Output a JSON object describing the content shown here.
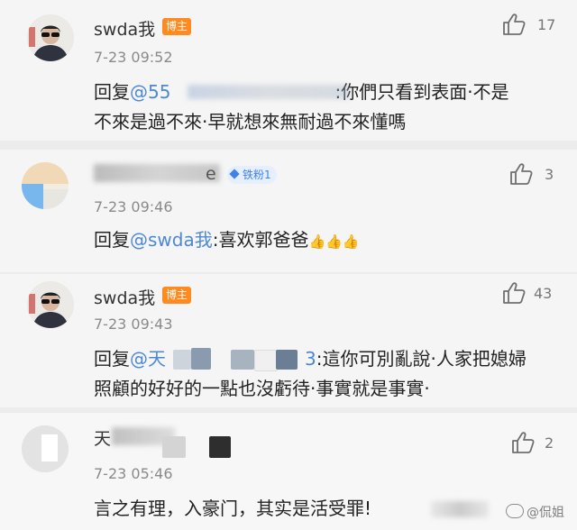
{
  "comments": [
    {
      "username": "swda我",
      "badge": "博主",
      "time": "7-23 09:52",
      "likes": "17",
      "reply_prefix": "回复",
      "mention": "@55",
      "line1_rest": ":你們只看到表面·不是",
      "line2": "不來是過不來·早就想來無耐過不來懂嗎"
    },
    {
      "username": "",
      "username_tail": "e",
      "fan_badge": "铁粉1",
      "time": "7-23 09:46",
      "likes": "3",
      "reply_prefix": "回复",
      "mention": "@swda我",
      "text": ":喜欢郭爸爸",
      "emoji": "👍👍👍"
    },
    {
      "username": "swda我",
      "badge": "博主",
      "time": "7-23 09:43",
      "likes": "43",
      "reply_prefix": "回复",
      "mention_start": "@天",
      "mention_end": "3",
      "line1_rest": ":這你可別亂說·人家把媳婦",
      "line2": "照顧的好好的一點也沒虧待·事實就是事實·"
    },
    {
      "username": "天",
      "time": "7-23 05:46",
      "likes": "2",
      "text": "言之有理，入豪门，其实是活受罪!"
    }
  ],
  "watermark": "@侃姐",
  "colors": {
    "badge": "#ff8a1f",
    "mention": "#4c88d6",
    "fans": "#3f82e8"
  }
}
